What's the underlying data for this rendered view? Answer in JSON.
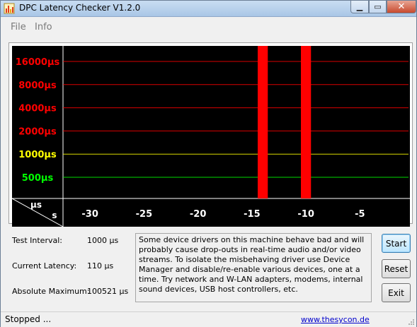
{
  "window": {
    "title": "DPC Latency Checker V1.2.0"
  },
  "menu": {
    "items": [
      "File",
      "Info"
    ]
  },
  "chart_data": {
    "type": "bar",
    "y_scale": "log",
    "y_tick_labels": [
      "16000µs",
      "8000µs",
      "4000µs",
      "2000µs",
      "1000µs",
      "500µs"
    ],
    "y_tick_values": [
      16000,
      8000,
      4000,
      2000,
      1000,
      500
    ],
    "y_tick_colors": [
      "#ff0000",
      "#ff0000",
      "#ff0000",
      "#ff0000",
      "#ffff00",
      "#00ff00"
    ],
    "y_unit_label": "µs",
    "x_unit_label": "s",
    "x_tick_labels": [
      "-30",
      "-25",
      "-20",
      "-15",
      "-10",
      "-5"
    ],
    "x_tick_values": [
      -30,
      -25,
      -20,
      -15,
      -10,
      -5
    ],
    "x": [
      -32,
      -31,
      -30,
      -29,
      -28,
      -27,
      -26,
      -25,
      -24,
      -23,
      -22,
      -21,
      -20,
      -19,
      -18,
      -17,
      -16,
      -15,
      -14,
      -13,
      -12,
      -11,
      -10,
      -9,
      -8,
      -7,
      -6,
      -5,
      -4,
      -3,
      -2,
      -1
    ],
    "values": [
      110,
      100,
      100,
      100,
      100,
      100,
      100,
      115,
      100,
      100,
      110,
      100,
      100,
      100,
      100,
      110,
      100,
      100,
      100521,
      110,
      100,
      95,
      100521,
      100,
      120,
      110,
      110,
      100,
      100,
      110,
      115,
      105
    ],
    "bar_colors": {
      "normal": "#00ff00",
      "high": "#ff0000"
    },
    "grid": true,
    "background": "#000000"
  },
  "stats": {
    "test_interval_label": "Test Interval:",
    "test_interval_value": "1000 µs",
    "current_latency_label": "Current Latency:",
    "current_latency_value": "110 µs",
    "absolute_maximum_label": "Absolute Maximum:",
    "absolute_maximum_value": "100521 µs"
  },
  "info_text": "Some device drivers on this machine behave bad and will probably cause drop-outs in real-time audio and/or video streams. To isolate the misbehaving driver use Device Manager and disable/re-enable various devices, one at a time. Try network and W-LAN adapters, modems, internal sound devices, USB host controllers, etc.",
  "buttons": {
    "start": "Start",
    "reset": "Reset",
    "exit": "Exit"
  },
  "status": {
    "text": "Stopped ...",
    "link": "www.thesycon.de"
  }
}
